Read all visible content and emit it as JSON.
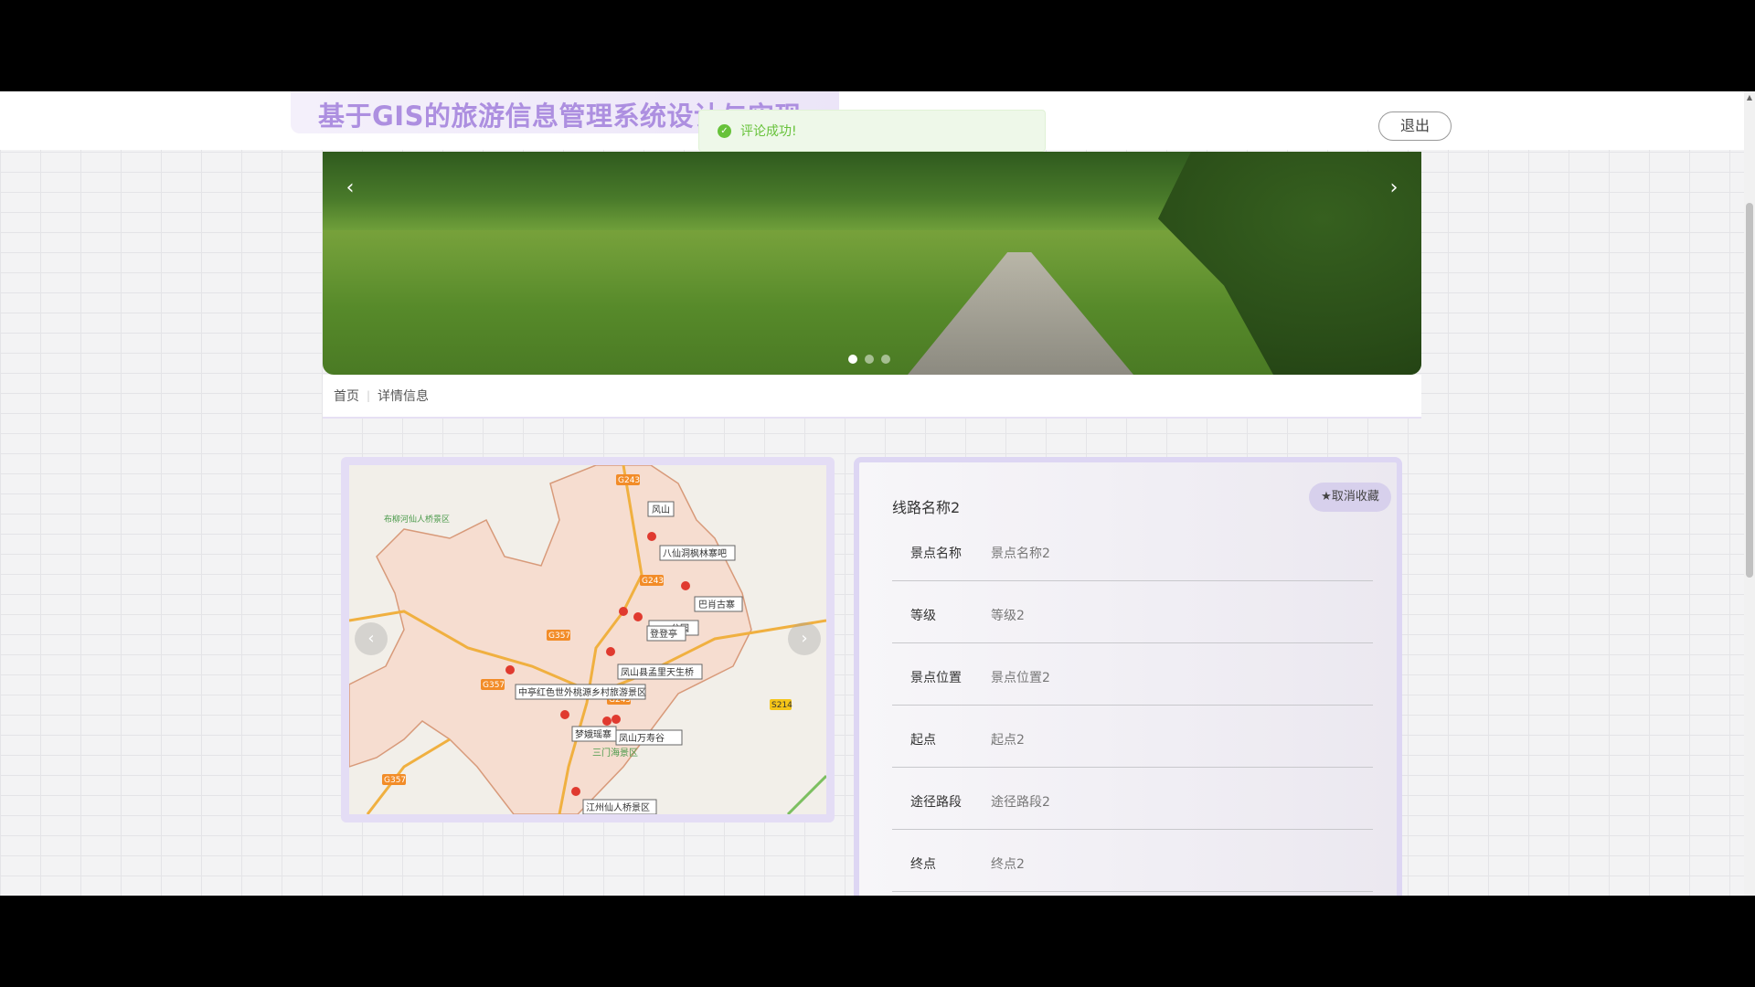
{
  "header": {
    "title": "基于GIS的旅游信息管理系统设计与实现",
    "logout_label": "退出"
  },
  "toast": {
    "message": "评论成功!",
    "icon": "check-circle-icon",
    "color": "#67c23a"
  },
  "banner": {
    "prev": "‹",
    "next": "›",
    "slide_count": 3,
    "active_slide": 1
  },
  "breadcrumb": {
    "home": "首页",
    "separator": "|",
    "current": "详情信息"
  },
  "map": {
    "prev": "‹",
    "next": "›",
    "labels": [
      "风山",
      "八仙洞枫林寨吧",
      "巴肖古寨",
      "凤山县孟里天生桥",
      "中亭红色世外桃源乡村旅游景区",
      "梦娥瑶寨",
      "凤山万寿谷",
      "三门海景区",
      "江州仙人桥景区",
      "布柳河仙人桥景区",
      "公园",
      "登登亭"
    ],
    "roads": [
      "G243",
      "G243",
      "G357",
      "G357",
      "G243",
      "S214",
      "G357"
    ]
  },
  "detail": {
    "route_name": "线路名称2",
    "favorite_label": "★取消收藏",
    "rows": [
      {
        "label": "景点名称",
        "value": "景点名称2"
      },
      {
        "label": "等级",
        "value": "等级2"
      },
      {
        "label": "景点位置",
        "value": "景点位置2"
      },
      {
        "label": "起点",
        "value": "起点2"
      },
      {
        "label": "途径路段",
        "value": "途径路段2"
      },
      {
        "label": "终点",
        "value": "终点2"
      }
    ]
  },
  "colors": {
    "accent": "#ad8fe0",
    "card_border": "#ddd6f3",
    "success": "#67c23a"
  }
}
